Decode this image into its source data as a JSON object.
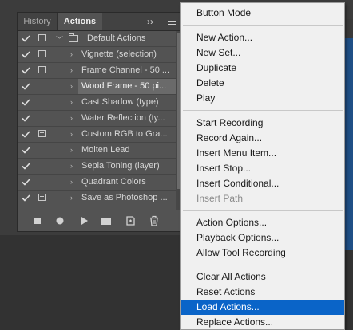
{
  "tabs": {
    "history": "History",
    "actions": "Actions"
  },
  "panel_icons": {
    "collapse": "chevrons-right-icon",
    "menu": "hamburger-menu-icon"
  },
  "actions_list": [
    {
      "label": "Default Actions",
      "checked": true,
      "dialog": true,
      "type": "set",
      "expanded": true
    },
    {
      "label": "Vignette (selection)",
      "checked": true,
      "dialog": true
    },
    {
      "label": "Frame Channel - 50 ...",
      "checked": true,
      "dialog": true
    },
    {
      "label": "Wood Frame - 50 pi...",
      "checked": true,
      "dialog": false,
      "selected": true
    },
    {
      "label": "Cast Shadow (type)",
      "checked": true,
      "dialog": false
    },
    {
      "label": "Water Reflection (ty...",
      "checked": true,
      "dialog": false
    },
    {
      "label": "Custom RGB to Gra...",
      "checked": true,
      "dialog": true
    },
    {
      "label": "Molten Lead",
      "checked": true,
      "dialog": false
    },
    {
      "label": "Sepia Toning (layer)",
      "checked": true,
      "dialog": false
    },
    {
      "label": "Quadrant Colors",
      "checked": true,
      "dialog": false
    },
    {
      "label": "Save as Photoshop ...",
      "checked": true,
      "dialog": true
    }
  ],
  "bottom_buttons": [
    "stop-icon",
    "record-icon",
    "play-icon",
    "new-set-folder-icon",
    "new-action-icon",
    "trash-icon"
  ],
  "menu": {
    "items": [
      {
        "label": "Button Mode"
      },
      {
        "label": "New Action..."
      },
      {
        "label": "New Set..."
      },
      {
        "label": "Duplicate"
      },
      {
        "label": "Delete"
      },
      {
        "label": "Play"
      },
      {
        "label": "Start Recording"
      },
      {
        "label": "Record Again..."
      },
      {
        "label": "Insert Menu Item..."
      },
      {
        "label": "Insert Stop..."
      },
      {
        "label": "Insert Conditional..."
      },
      {
        "label": "Insert Path",
        "disabled": true
      },
      {
        "label": "Action Options..."
      },
      {
        "label": "Playback Options..."
      },
      {
        "label": "Allow Tool Recording"
      },
      {
        "label": "Clear All Actions"
      },
      {
        "label": "Reset Actions"
      },
      {
        "label": "Load Actions...",
        "highlighted": true
      },
      {
        "label": "Replace Actions..."
      }
    ]
  },
  "colors": {
    "menu_highlight": "#0a64c8",
    "panel_bg": "#535353",
    "menu_bg": "#f0f0f0"
  }
}
